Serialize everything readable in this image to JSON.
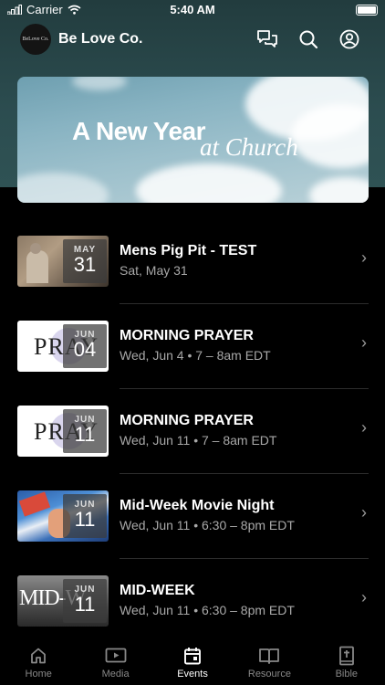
{
  "status_bar": {
    "carrier": "Carrier",
    "time": "5:40 AM"
  },
  "header": {
    "logo_text": "BeLove Co.",
    "title": "Be Love Co."
  },
  "hero": {
    "line1": "A New Year",
    "line2": "at Church"
  },
  "events": [
    {
      "month": "MAY",
      "day": "31",
      "title": "Mens Pig Pit - TEST",
      "subtitle": "Sat, May 31",
      "thumb": "photo"
    },
    {
      "month": "JUN",
      "day": "04",
      "title": "MORNING PRAYER",
      "subtitle": "Wed, Jun 4 • 7 – 8am EDT",
      "thumb": "pray"
    },
    {
      "month": "JUN",
      "day": "11",
      "title": "MORNING PRAYER",
      "subtitle": "Wed, Jun 11 • 7 – 8am EDT",
      "thumb": "pray"
    },
    {
      "month": "JUN",
      "day": "11",
      "title": "Mid-Week Movie Night",
      "subtitle": "Wed, Jun 11 • 6:30 – 8pm EDT",
      "thumb": "movie"
    },
    {
      "month": "JUN",
      "day": "11",
      "title": "MID-WEEK",
      "subtitle": "Wed, Jun 11 • 6:30 – 8pm EDT",
      "thumb": "midweek"
    }
  ],
  "thumb_text": {
    "pray": "PRAY",
    "midweek": "MID-W"
  },
  "tabs": [
    {
      "label": "Home",
      "icon": "home-icon"
    },
    {
      "label": "Media",
      "icon": "media-icon"
    },
    {
      "label": "Events",
      "icon": "calendar-icon",
      "active": true
    },
    {
      "label": "Resource",
      "icon": "book-icon"
    },
    {
      "label": "Bible",
      "icon": "bible-icon"
    }
  ],
  "colors": {
    "header_bg": "#2c4d50",
    "background": "#000000",
    "muted_text": "#a8a8a8"
  }
}
